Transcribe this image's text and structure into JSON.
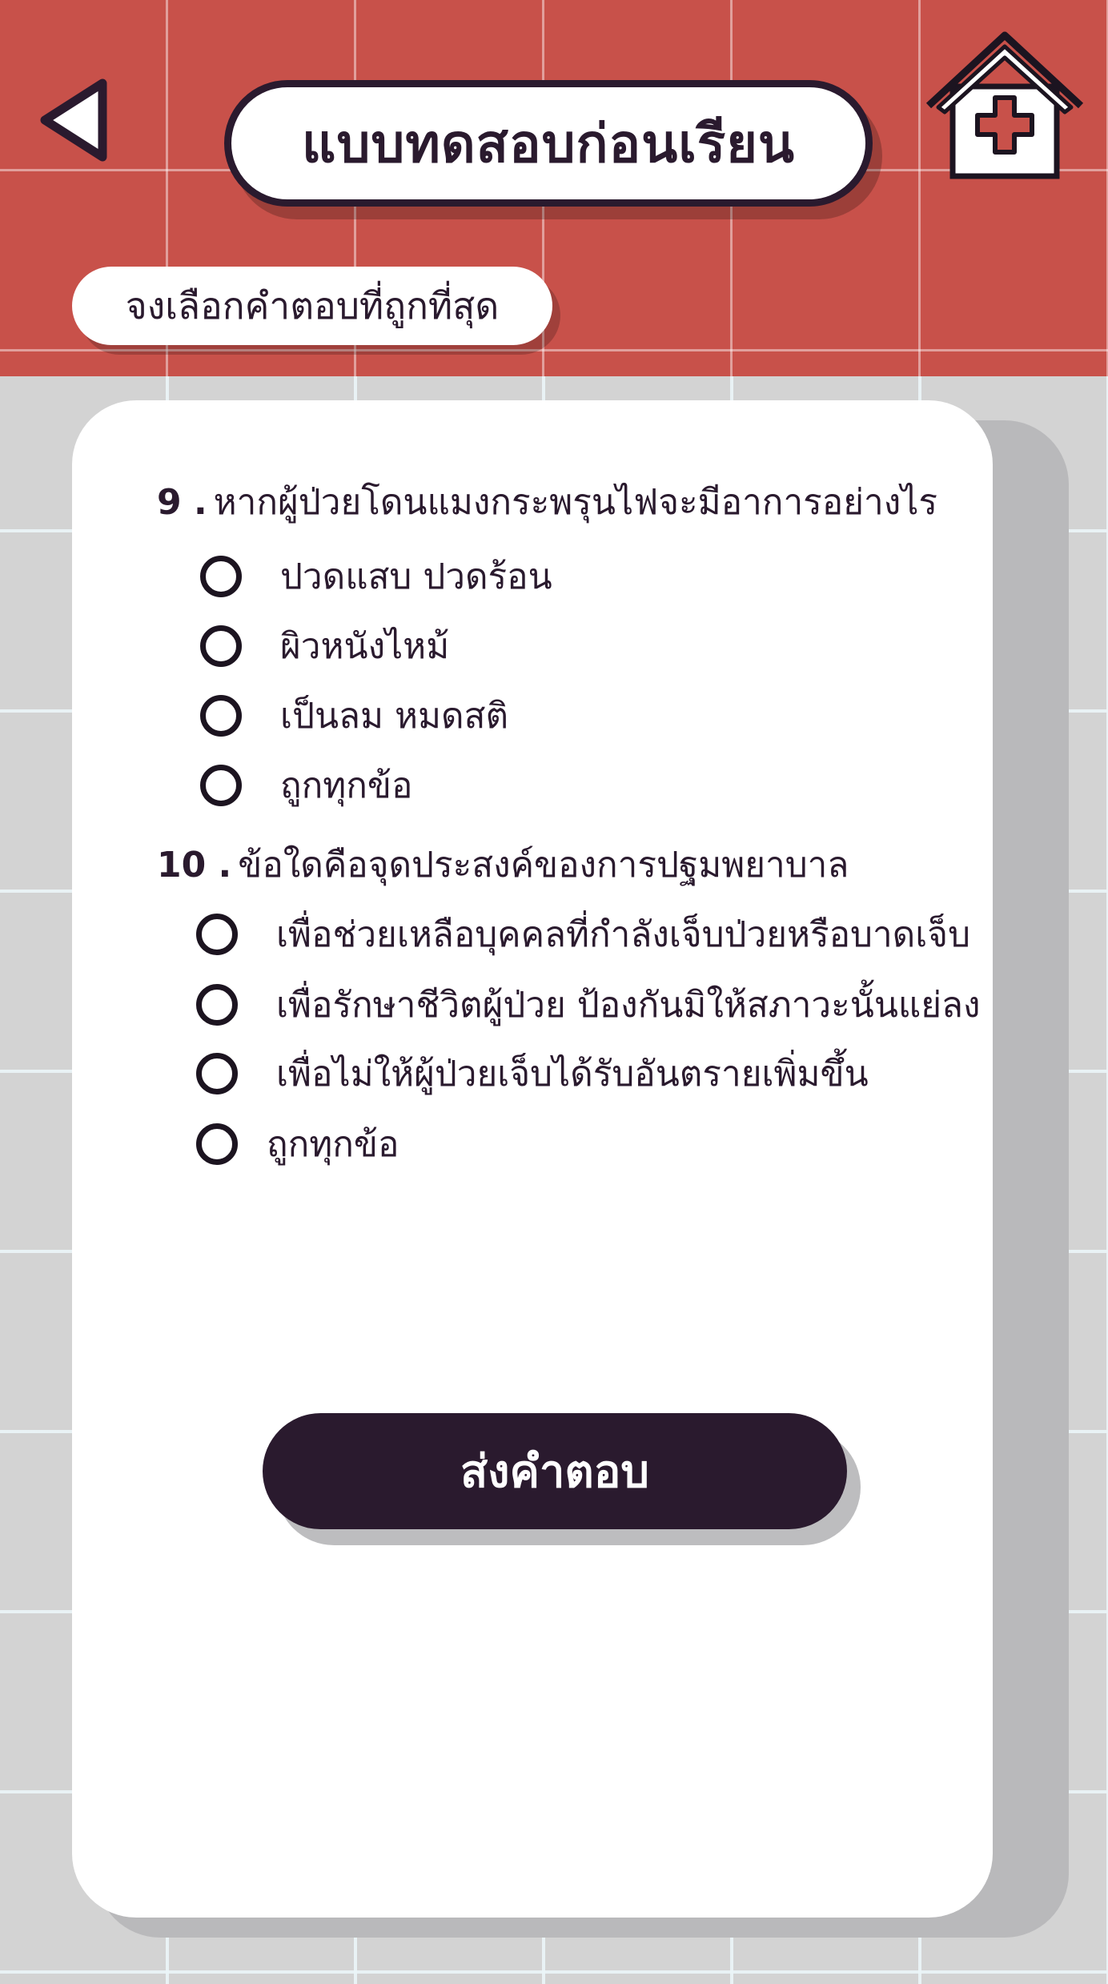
{
  "header": {
    "title": "แบบทดสอบก่อนเรียน",
    "instruction": "จงเลือกคำตอบที่ถูกที่สุด",
    "back_icon": "triangle-left-icon",
    "home_icon": "hospital-home-icon"
  },
  "questions": [
    {
      "number": "9",
      "text": "หากผู้ป่วยโดนแมงกระพรุนไฟจะมีอาการอย่างไร",
      "options": [
        "ปวดแสบ ปวดร้อน",
        "ผิวหนังไหม้",
        "เป็นลม หมดสติ",
        "ถูกทุกข้อ"
      ]
    },
    {
      "number": "10",
      "text": "ข้อใดคือจุดประสงค์ของการปฐมพยาบาล",
      "options": [
        "เพื่อช่วยเหลือบุคคลที่กำลังเจ็บป่วยหรือบาดเจ็บ",
        "เพื่อรักษาชีวิตผู้ป่วย ป้องกันมิให้สภาวะนั้นแย่ลง",
        "เพื่อไม่ให้ผู้ป่วยเจ็บได้รับอันตรายเพิ่มขึ้น",
        "ถูกทุกข้อ"
      ]
    }
  ],
  "submit_label": "ส่งคำตอบ",
  "colors": {
    "header_red": "#c8514a",
    "dark": "#2a1a2e",
    "background": "#d3d3d3"
  }
}
